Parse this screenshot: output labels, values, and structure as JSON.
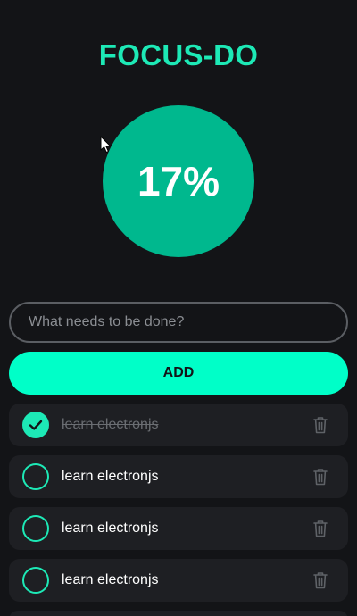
{
  "app": {
    "title": "FOCUS-DO",
    "progress_label": "17%",
    "progress_fraction": 0.17
  },
  "input": {
    "placeholder": "What needs to be done?",
    "value": ""
  },
  "add_button": {
    "label": "ADD"
  },
  "tasks": [
    {
      "label": "learn electronjs",
      "completed": true
    },
    {
      "label": "learn electronjs",
      "completed": false
    },
    {
      "label": "learn electronjs",
      "completed": false
    },
    {
      "label": "learn electronjs",
      "completed": false
    }
  ],
  "colors": {
    "accent": "#1de9b6",
    "button": "#00ffc8",
    "progress_fill": "#00b88e",
    "background": "#131417",
    "card": "#1e1f23"
  },
  "icons": {
    "check": "check-icon",
    "delete": "trash-icon",
    "cursor": "mouse-pointer-icon"
  }
}
